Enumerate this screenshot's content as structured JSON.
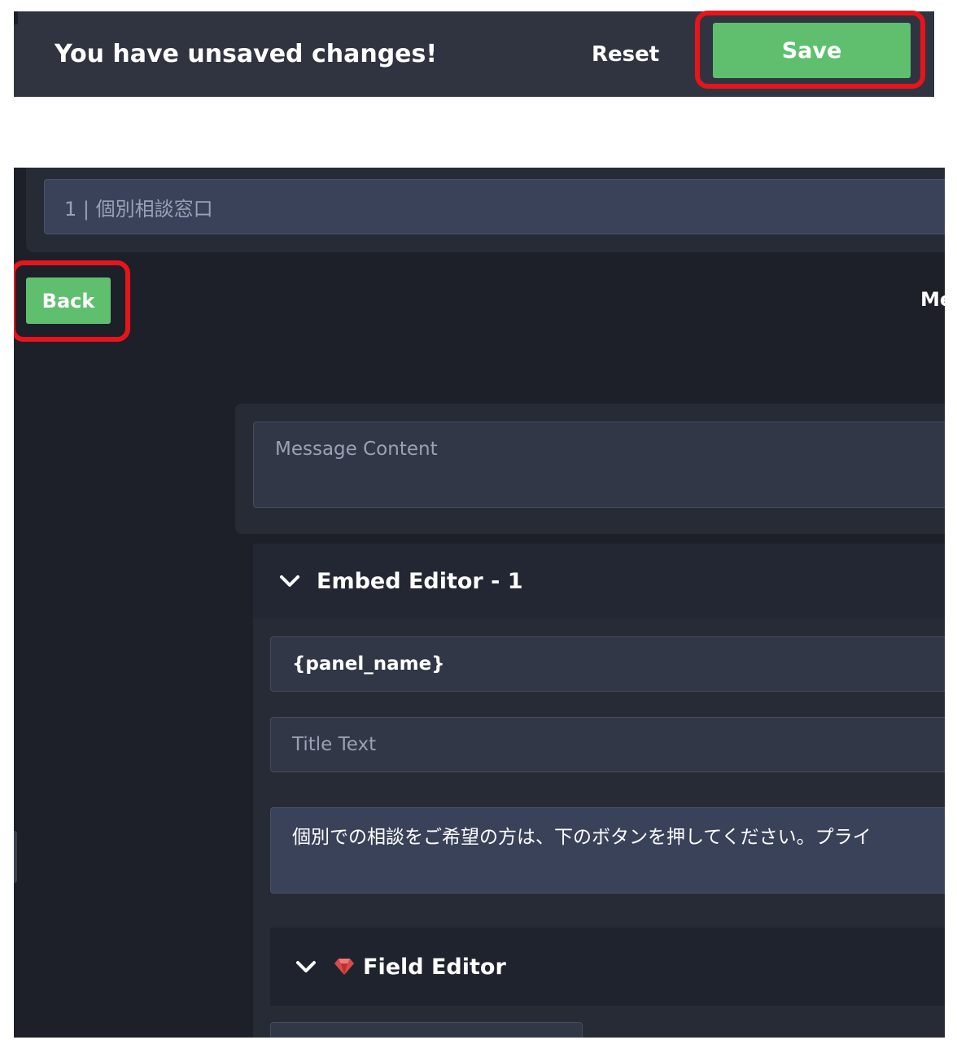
{
  "unsaved_bar": {
    "message": "You have unsaved changes!",
    "reset_label": "Reset",
    "save_label": "Save"
  },
  "panel": {
    "selected": "1 | 個別相談窓口"
  },
  "back_label": "Back",
  "truncated_label": "Me",
  "message_content": {
    "placeholder": "Message Content"
  },
  "embed_editor": {
    "title": "Embed Editor -  1",
    "author_value": "{panel_name}",
    "title_placeholder": "Title Text",
    "description_value": "個別での相談をご希望の方は、下のボタンを押してください。プライ"
  },
  "field_editor": {
    "title": "Field Editor"
  },
  "colors": {
    "accent_green": "#5fbf6f",
    "highlight_red": "#e8141b",
    "background_dark": "#1d2029"
  }
}
